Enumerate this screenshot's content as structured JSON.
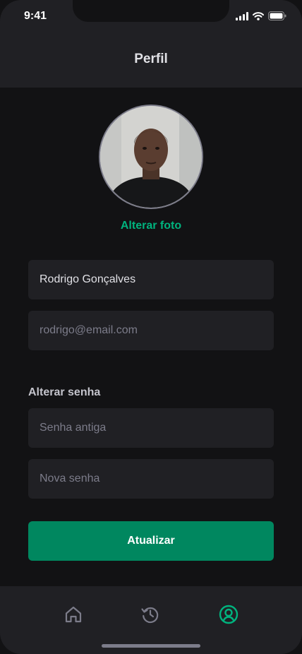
{
  "status_bar": {
    "time": "9:41"
  },
  "header": {
    "title": "Perfil"
  },
  "profile": {
    "change_photo_label": "Alterar foto",
    "name_value": "Rodrigo Gonçalves",
    "email_placeholder": "rodrigo@email.com"
  },
  "password_section": {
    "label": "Alterar senha",
    "old_password_placeholder": "Senha antiga",
    "new_password_placeholder": "Nova senha"
  },
  "actions": {
    "update_label": "Atualizar"
  },
  "tab_bar": {
    "items": [
      {
        "icon": "home-icon",
        "active": false
      },
      {
        "icon": "history-icon",
        "active": false
      },
      {
        "icon": "user-circle-icon",
        "active": true
      }
    ]
  },
  "colors": {
    "background": "#121214",
    "surface": "#202024",
    "accent": "#00b37e",
    "button": "#00875f",
    "muted": "#7c7c8a"
  }
}
